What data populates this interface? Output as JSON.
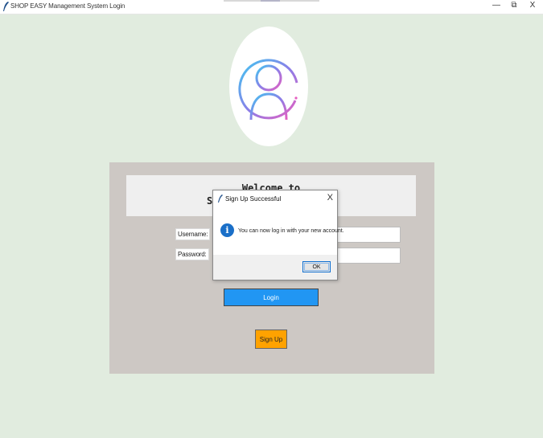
{
  "window": {
    "title": "SHOP EASY Management System Login",
    "minimize": "—",
    "restore": "⧉",
    "close": "X"
  },
  "colors": {
    "background": "#e1ecdf",
    "panel": "#cdc8c4",
    "login_button": "#2196f3",
    "signup_button": "#ffa200",
    "info_icon": "#1a6fc8"
  },
  "welcome": {
    "line1": "Welcome to",
    "line2_visible": "S"
  },
  "form": {
    "username_label": "Username:",
    "password_label": "Password:",
    "username_value": "",
    "password_value": ""
  },
  "buttons": {
    "login": "Login",
    "signup": "Sign Up"
  },
  "dialog": {
    "title": "Sign Up Successful",
    "close": "X",
    "icon": "i",
    "message": "You can now log in with your new account.",
    "ok": "OK"
  }
}
